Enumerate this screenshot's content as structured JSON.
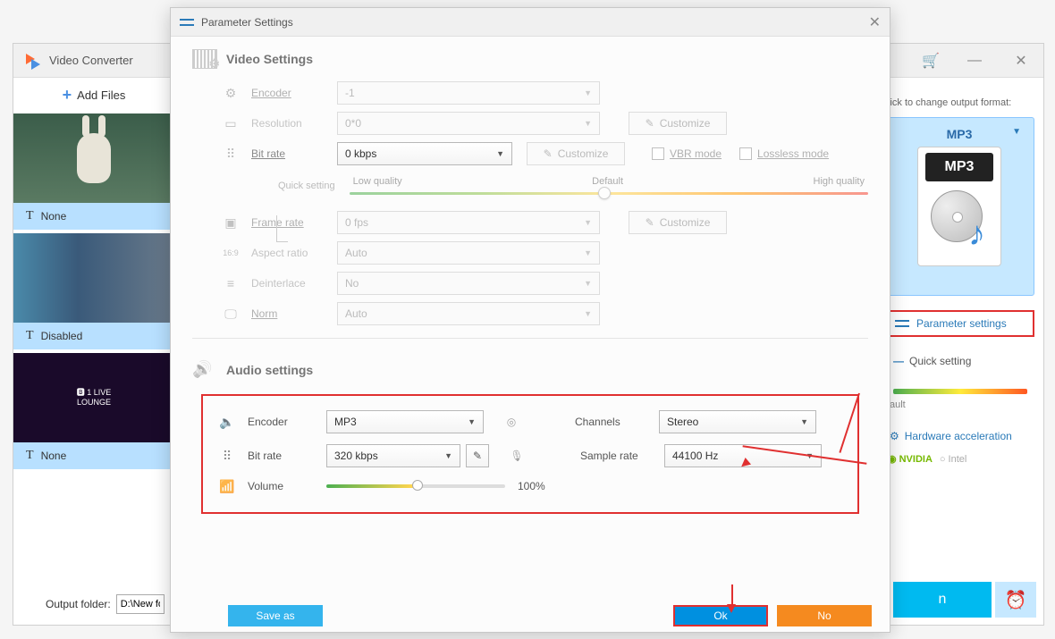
{
  "app": {
    "title": "Video Converter",
    "add_files": "Add Files",
    "output_folder_label": "Output folder:",
    "output_folder_value": "D:\\New fo",
    "convert_partial": "n"
  },
  "thumbs": [
    {
      "label": "None"
    },
    {
      "label": "Disabled"
    },
    {
      "label": "None"
    }
  ],
  "right": {
    "hint": "lick to change output format:",
    "format": "MP3",
    "mp3_badge": "MP3",
    "param_settings": "Parameter settings",
    "quick_setting": "Quick setting",
    "quality_ault": "ault",
    "hw_accel": "Hardware acceleration",
    "nvidia": "NVIDIA",
    "intel": "Intel"
  },
  "dialog": {
    "title": "Parameter Settings",
    "video_section": "Video Settings",
    "audio_section": "Audio settings",
    "video": {
      "encoder_label": "Encoder",
      "encoder_value": "-1",
      "resolution_label": "Resolution",
      "resolution_value": "0*0",
      "bitrate_label": "Bit rate",
      "bitrate_value": "0 kbps",
      "vbr_mode": "VBR mode",
      "lossless_mode": "Lossless mode",
      "quick_setting": "Quick setting",
      "low_q": "Low quality",
      "default_q": "Default",
      "high_q": "High quality",
      "framerate_label": "Frame rate",
      "framerate_value": "0 fps",
      "aspect_label": "Aspect ratio",
      "aspect_value": "Auto",
      "deinterlace_label": "Deinterlace",
      "deinterlace_value": "No",
      "norm_label": "Norm",
      "norm_value": "Auto",
      "customize": "Customize"
    },
    "audio": {
      "encoder_label": "Encoder",
      "encoder_value": "MP3",
      "bitrate_label": "Bit rate",
      "bitrate_value": "320 kbps",
      "volume_label": "Volume",
      "volume_value": "100%",
      "channels_label": "Channels",
      "channels_value": "Stereo",
      "samplerate_label": "Sample rate",
      "samplerate_value": "44100 Hz"
    },
    "buttons": {
      "save_as": "Save as",
      "ok": "Ok",
      "no": "No"
    }
  }
}
